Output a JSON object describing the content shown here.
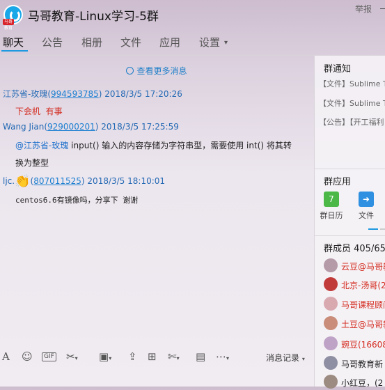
{
  "header": {
    "title": "马哥教育-Linux学习-5群",
    "logo_badge": "马哥教育",
    "report_label": "举报"
  },
  "tabs": [
    {
      "label": "聊天",
      "active": true
    },
    {
      "label": "公告",
      "active": false
    },
    {
      "label": "相册",
      "active": false
    },
    {
      "label": "文件",
      "active": false
    },
    {
      "label": "应用",
      "active": false
    },
    {
      "label": "设置",
      "active": false
    }
  ],
  "chat": {
    "more_messages": "查看更多消息",
    "messages": [
      {
        "sender": "江苏省-玫瑰",
        "qq": "994593785",
        "time": "2018/3/5 17:20:26",
        "text_a": "下会机",
        "text_b": "有事"
      },
      {
        "sender": "Wang Jian",
        "qq": "929000201",
        "time": "2018/3/5 17:25:59",
        "mention": "@江苏省-玫瑰",
        "line1": " input() 输入的内容存储为字符串型，需要使用 int() 将其转",
        "line2": "换为整型"
      },
      {
        "sender": "ljc.",
        "emoji": "👏",
        "qq": "807011525",
        "time": "2018/3/5 18:10:01",
        "text": "centos6.6有镜像吗，分享下  谢谢"
      }
    ]
  },
  "toolbar": {
    "font_icon": "A",
    "emoji_icon": "☺",
    "gif_label": "GIF",
    "history_label": "消息记录"
  },
  "right_panel": {
    "notice_title": "群通知",
    "notices": [
      "【文件】Sublime Te",
      "【文件】Sublime Te",
      "【公告】【开工福利"
    ],
    "apps_title": "群应用",
    "apps": [
      {
        "label": "群日历",
        "icon": "calendar-icon",
        "color": "#4cb848",
        "glyph": "7"
      },
      {
        "label": "文件",
        "icon": "file-icon",
        "color": "#2f8fe0",
        "glyph": "➜"
      }
    ],
    "members_title": "群成员 405/65",
    "members": [
      {
        "name": "云豆@马哥教",
        "color": "#d42a1e"
      },
      {
        "name": "北京-汤哥(2",
        "color": "#d42a1e"
      },
      {
        "name": "马哥课程顾问",
        "color": "#d42a1e"
      },
      {
        "name": "土豆@马哥教",
        "color": "#d42a1e"
      },
      {
        "name": "豌豆(16608",
        "color": "#d42a1e"
      },
      {
        "name": "马哥教育新",
        "color": "#222"
      },
      {
        "name": "小红豆，(2",
        "color": "#222"
      }
    ]
  }
}
